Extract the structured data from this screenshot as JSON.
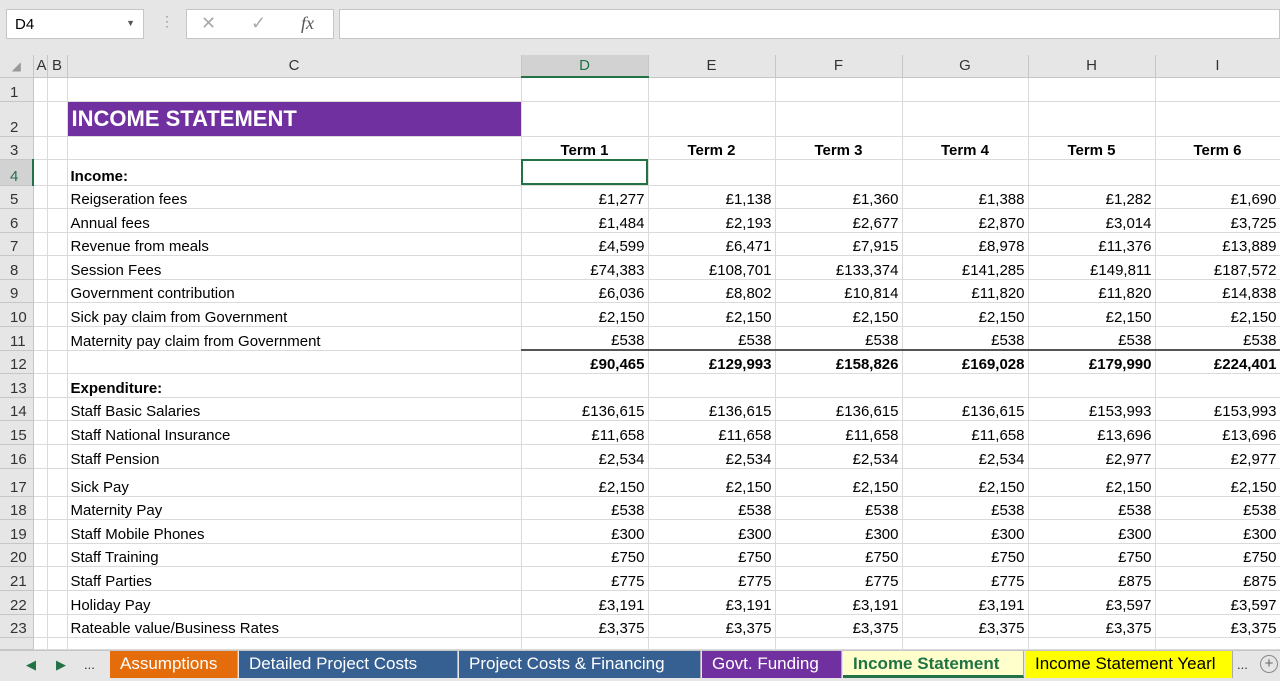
{
  "formula_bar": {
    "name_box": "D4",
    "formula": ""
  },
  "column_headers": [
    "A",
    "B",
    "C",
    "D",
    "E",
    "F",
    "G",
    "H",
    "I"
  ],
  "selected_cell": "D4",
  "title": "INCOME STATEMENT",
  "terms": [
    "Term 1",
    "Term 2",
    "Term 3",
    "Term 4",
    "Term 5",
    "Term 6"
  ],
  "rows": [
    {
      "n": "1",
      "label": "",
      "values": []
    },
    {
      "n": "2",
      "label": "",
      "values": []
    },
    {
      "n": "3",
      "label": "",
      "values": []
    },
    {
      "n": "4",
      "label": "Income:",
      "bold": true,
      "values": []
    },
    {
      "n": "5",
      "label": "Reigseration fees",
      "values": [
        "£1,277",
        "£1,138",
        "£1,360",
        "£1,388",
        "£1,282",
        "£1,690"
      ]
    },
    {
      "n": "6",
      "label": "Annual fees",
      "values": [
        "£1,484",
        "£2,193",
        "£2,677",
        "£2,870",
        "£3,014",
        "£3,725"
      ]
    },
    {
      "n": "7",
      "label": "Revenue from meals",
      "values": [
        "£4,599",
        "£6,471",
        "£7,915",
        "£8,978",
        "£11,376",
        "£13,889"
      ]
    },
    {
      "n": "8",
      "label": "Session Fees",
      "values": [
        "£74,383",
        "£108,701",
        "£133,374",
        "£141,285",
        "£149,811",
        "£187,572"
      ]
    },
    {
      "n": "9",
      "label": "Government contribution",
      "values": [
        "£6,036",
        "£8,802",
        "£10,814",
        "£11,820",
        "£11,820",
        "£14,838"
      ]
    },
    {
      "n": "10",
      "label": "Sick pay claim from Government",
      "values": [
        "£2,150",
        "£2,150",
        "£2,150",
        "£2,150",
        "£2,150",
        "£2,150"
      ]
    },
    {
      "n": "11",
      "label": "Maternity pay claim from Government",
      "values": [
        "£538",
        "£538",
        "£538",
        "£538",
        "£538",
        "£538"
      ]
    },
    {
      "n": "12",
      "label": "",
      "total": true,
      "values": [
        "£90,465",
        "£129,993",
        "£158,826",
        "£169,028",
        "£179,990",
        "£224,401"
      ]
    },
    {
      "n": "13",
      "label": "Expenditure:",
      "bold": true,
      "values": []
    },
    {
      "n": "14",
      "label": "Staff Basic Salaries",
      "values": [
        "£136,615",
        "£136,615",
        "£136,615",
        "£136,615",
        "£153,993",
        "£153,993"
      ]
    },
    {
      "n": "15",
      "label": "Staff National Insurance",
      "values": [
        "£11,658",
        "£11,658",
        "£11,658",
        "£11,658",
        "£13,696",
        "£13,696"
      ]
    },
    {
      "n": "16",
      "label": "Staff Pension",
      "values": [
        "£2,534",
        "£2,534",
        "£2,534",
        "£2,534",
        "£2,977",
        "£2,977"
      ]
    },
    {
      "n": "17",
      "label": "Sick Pay",
      "values": [
        "£2,150",
        "£2,150",
        "£2,150",
        "£2,150",
        "£2,150",
        "£2,150"
      ]
    },
    {
      "n": "18",
      "label": "Maternity Pay",
      "values": [
        "£538",
        "£538",
        "£538",
        "£538",
        "£538",
        "£538"
      ]
    },
    {
      "n": "19",
      "label": "Staff Mobile Phones",
      "values": [
        "£300",
        "£300",
        "£300",
        "£300",
        "£300",
        "£300"
      ]
    },
    {
      "n": "20",
      "label": "Staff Training",
      "values": [
        "£750",
        "£750",
        "£750",
        "£750",
        "£750",
        "£750"
      ]
    },
    {
      "n": "21",
      "label": "Staff Parties",
      "values": [
        "£775",
        "£775",
        "£775",
        "£775",
        "£875",
        "£875"
      ]
    },
    {
      "n": "22",
      "label": "Holiday Pay",
      "values": [
        "£3,191",
        "£3,191",
        "£3,191",
        "£3,191",
        "£3,597",
        "£3,597"
      ]
    },
    {
      "n": "23",
      "label": "Rateable value/Business Rates",
      "values": [
        "£3,375",
        "£3,375",
        "£3,375",
        "£3,375",
        "£3,375",
        "£3,375"
      ]
    }
  ],
  "sheet_tabs": [
    {
      "label": "Assumptions",
      "bg": "#e46c0a",
      "color": "#ffffff"
    },
    {
      "label": "Detailed Project  Costs",
      "bg": "#366092",
      "color": "#ffffff"
    },
    {
      "label": "Project Costs & Financing",
      "bg": "#366092",
      "color": "#ffffff"
    },
    {
      "label": "Govt. Funding",
      "bg": "#7030a0",
      "color": "#ffffff"
    },
    {
      "label": "Income Statement",
      "bg": "#ffffcc",
      "color": "#217346",
      "active": true
    },
    {
      "label": "Income Statement Yearl",
      "bg": "#ffff00",
      "color": "#000000"
    }
  ],
  "tab_nav": {
    "more": "..."
  }
}
